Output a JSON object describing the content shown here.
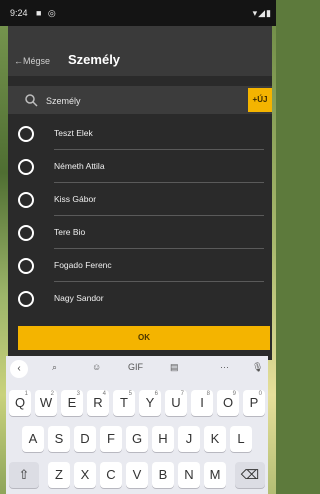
{
  "status_bar": {
    "time": "9:24",
    "left_icons": "■ ◎",
    "right_icons": "▾◢▮"
  },
  "header": {
    "back_label": "←Mégse",
    "title": "Személy"
  },
  "search": {
    "value": "Személy",
    "placeholder": "",
    "add_label": "+ÚJ"
  },
  "people": [
    {
      "name": "Teszt Elek"
    },
    {
      "name": "Németh Attila"
    },
    {
      "name": "Kiss Gábor"
    },
    {
      "name": "Tere Bio"
    },
    {
      "name": "Fogado Ferenc"
    },
    {
      "name": "Nagy Sandor"
    }
  ],
  "ok_label": "OK",
  "keyboard": {
    "toolbar": {
      "back": "‹",
      "search": "⌕",
      "sticker": "☺",
      "gif": "GIF",
      "clipboard": "▤",
      "more": "···",
      "mic": "🎙"
    },
    "row1": [
      "Q",
      "W",
      "E",
      "R",
      "T",
      "Y",
      "U",
      "I",
      "O",
      "P"
    ],
    "row1_hints": [
      "1",
      "2",
      "3",
      "4",
      "5",
      "6",
      "7",
      "8",
      "9",
      "0"
    ],
    "row2": [
      "A",
      "S",
      "D",
      "F",
      "G",
      "H",
      "J",
      "K",
      "L"
    ],
    "row3_shift": "⇧",
    "row3": [
      "Z",
      "X",
      "C",
      "V",
      "B",
      "N",
      "M"
    ],
    "row3_delete": "⌫"
  },
  "colors": {
    "accent": "#f4b400",
    "dialog_bg": "#2a2a2a",
    "header_bg": "#3a3a3a"
  }
}
